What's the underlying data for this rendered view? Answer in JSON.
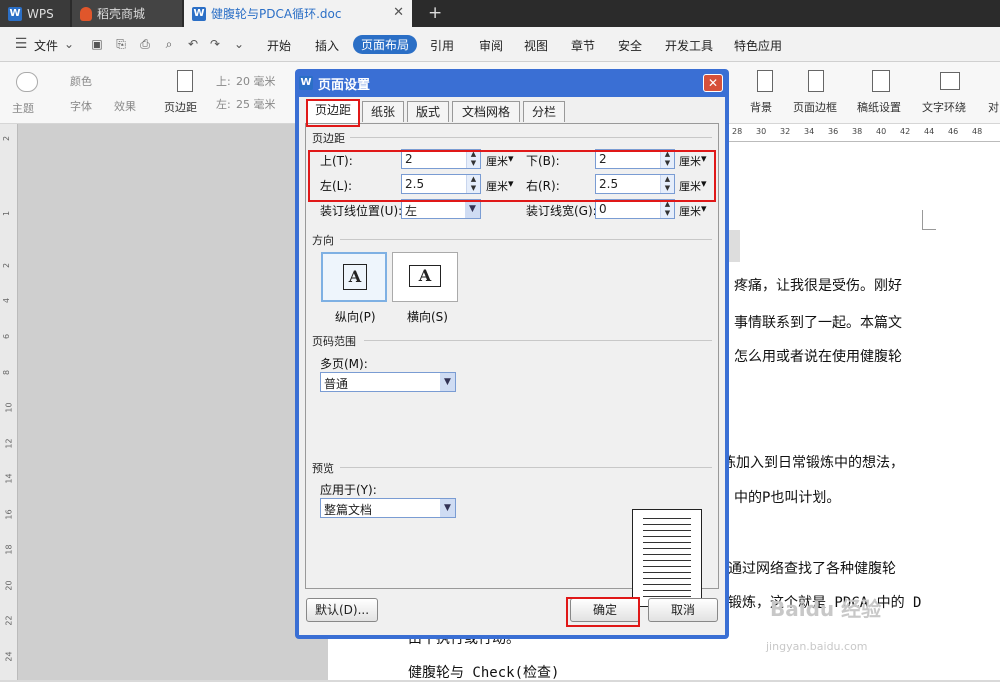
{
  "titlebar": {
    "tabs": [
      {
        "label": "WPS"
      },
      {
        "label": "稻壳商城"
      },
      {
        "label": "健腹轮与PDCA循环.doc"
      }
    ],
    "new_tab": "+",
    "close": "✕"
  },
  "menu": {
    "file": "文件",
    "items": [
      "开始",
      "插入",
      "页面布局",
      "引用",
      "审阅",
      "视图",
      "章节",
      "安全",
      "开发工具",
      "特色应用"
    ],
    "active": "页面布局"
  },
  "ribbon": {
    "theme": "主题",
    "colors": "颜色",
    "fonts": "字体",
    "effects": "效果",
    "margins": "页边距",
    "top_label": "上:",
    "top_value": "20 毫米",
    "left_label": "左:",
    "left_value": "25 毫米",
    "background": "背景",
    "page_border": "页面边框",
    "grid_paper": "稿纸设置",
    "text_wrap": "文字环绕",
    "align": "对"
  },
  "ruler": {
    "top": [
      "28",
      "30",
      "32",
      "34",
      "36",
      "38",
      "40",
      "42",
      "44",
      "46",
      "48"
    ],
    "left": [
      "2",
      "1",
      "2",
      "4",
      "6",
      "8",
      "10",
      "12",
      "14",
      "16",
      "18",
      "20",
      "22",
      "24"
    ]
  },
  "document": {
    "lines": [
      "疼痛，让我很是受伤。刚好",
      "事情联系到了一起。本篇文",
      "怎么用或者说在使用健腹轮",
      "练加入到日常锻炼中的想法，",
      "中的P也叫计划。",
      "通过网络查找了各种健腹轮",
      "锻炼，这个就是 PDCA 中的 D",
      "由十执行或行动。",
      "健腹轮与 Check(检查)"
    ],
    "watermark": "Baidu 经验",
    "watermark_url": "jingyan.baidu.com"
  },
  "dialog": {
    "title": "页面设置",
    "close": "✕",
    "tabs": [
      "页边距",
      "纸张",
      "版式",
      "文档网格",
      "分栏"
    ],
    "active_tab": "页边距",
    "margins_group": "页边距",
    "top": {
      "label": "上(T):",
      "value": "2",
      "unit": "厘米"
    },
    "bottom": {
      "label": "下(B):",
      "value": "2",
      "unit": "厘米"
    },
    "left": {
      "label": "左(L):",
      "value": "2.5",
      "unit": "厘米"
    },
    "right": {
      "label": "右(R):",
      "value": "2.5",
      "unit": "厘米"
    },
    "gutter_pos": {
      "label": "装订线位置(U):",
      "value": "左"
    },
    "gutter": {
      "label": "装订线宽(G):",
      "value": "0",
      "unit": "厘米"
    },
    "orientation_group": "方向",
    "portrait": "纵向(P)",
    "landscape": "横向(S)",
    "pages_group": "页码范围",
    "multi_pages": {
      "label": "多页(M):",
      "value": "普通"
    },
    "preview_group": "预览",
    "apply_to": {
      "label": "应用于(Y):",
      "value": "整篇文档"
    },
    "default_btn": "默认(D)...",
    "ok_btn": "确定",
    "cancel_btn": "取消"
  },
  "colors": {
    "accent": "#2b6fc6",
    "dialog_frame": "#3a6fd4",
    "highlight": "#e01818"
  }
}
